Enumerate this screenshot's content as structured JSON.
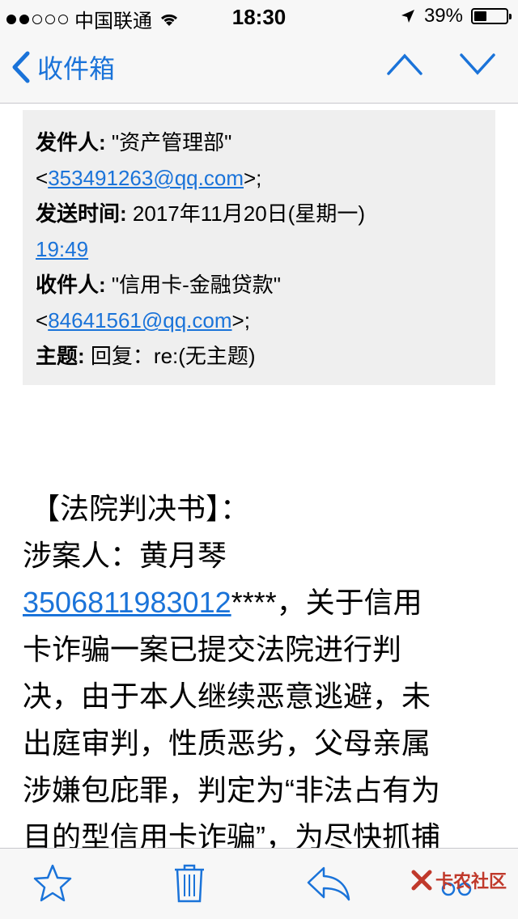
{
  "status_bar": {
    "carrier": "中国联通",
    "time": "18:30",
    "battery": "39%",
    "battery_level": 0.39
  },
  "nav": {
    "back_label": "收件箱"
  },
  "email": {
    "from_label": "发件人:",
    "from_name": "\"资产管理部\"",
    "from_addr": "353491263@qq.com",
    "sent_label": "发送时间:",
    "sent_date": "2017年11月20日(星期一)",
    "sent_time": "19:49",
    "to_label": "收件人:",
    "to_name": "\"信用卡-金融贷款\"",
    "to_addr": "84641561@qq.com",
    "subject_label": "主题:",
    "subject": "回复：re:(无主题)"
  },
  "body": {
    "title": "【法院判决书】：",
    "person_line": "涉案人：黄月琴",
    "id_number": "3506811983012",
    "id_mask": "****，关于信用",
    "lines": [
      "卡诈骗一案已提交法院进行判",
      "决，由于本人继续恶意逃避，未",
      "出庭审判，性质恶劣，父母亲属",
      "涉嫌包庇罪，判定为“非法占有为",
      "目的型信用卡诈骗”，为尽快抓捕"
    ]
  },
  "watermark": {
    "text": "卡农社区"
  },
  "colors": {
    "link": "#1a73d9",
    "bar_bg": "#f7f7f7",
    "header_bg": "#efefef"
  }
}
